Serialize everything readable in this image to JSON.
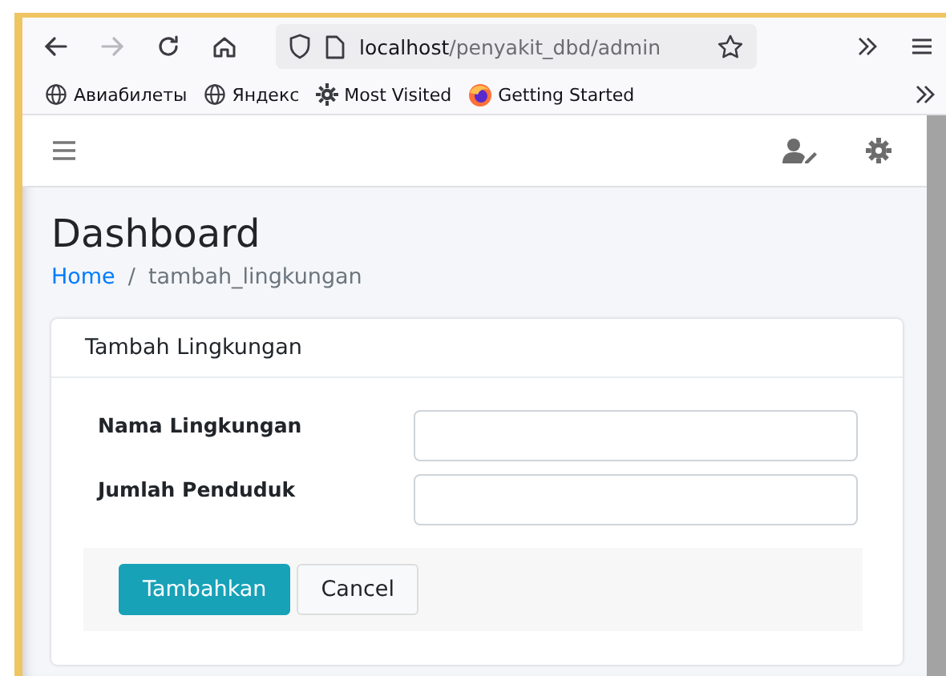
{
  "browser": {
    "nav_buttons": [
      {
        "kind": "back",
        "disabled": false
      },
      {
        "kind": "forward",
        "disabled": true
      },
      {
        "kind": "reload",
        "disabled": false
      },
      {
        "kind": "home",
        "disabled": false
      }
    ],
    "address": {
      "host": "localhost",
      "path": "/penyakit_dbd/admin"
    },
    "bookmarks": [
      {
        "label": "Авиабилеты",
        "kind": "globe"
      },
      {
        "label": "Яндекс",
        "kind": "globe"
      },
      {
        "label": "Most Visited",
        "kind": "gear"
      },
      {
        "label": "Getting Started",
        "kind": "firefox"
      }
    ]
  },
  "page": {
    "title": "Dashboard",
    "breadcrumb": [
      {
        "label": "Home",
        "kind": "link"
      },
      {
        "label": "tambah_lingkungan",
        "kind": "current"
      }
    ],
    "breadcrumb_separator": "/"
  },
  "card": {
    "title": "Tambah Lingkungan",
    "fields": [
      {
        "label": "Nama Lingkungan"
      },
      {
        "label": "Jumlah Penduduk"
      }
    ],
    "buttons": [
      {
        "label": "Tambahkan",
        "kind": "primary"
      },
      {
        "label": "Cancel",
        "kind": "secondary"
      }
    ]
  }
}
